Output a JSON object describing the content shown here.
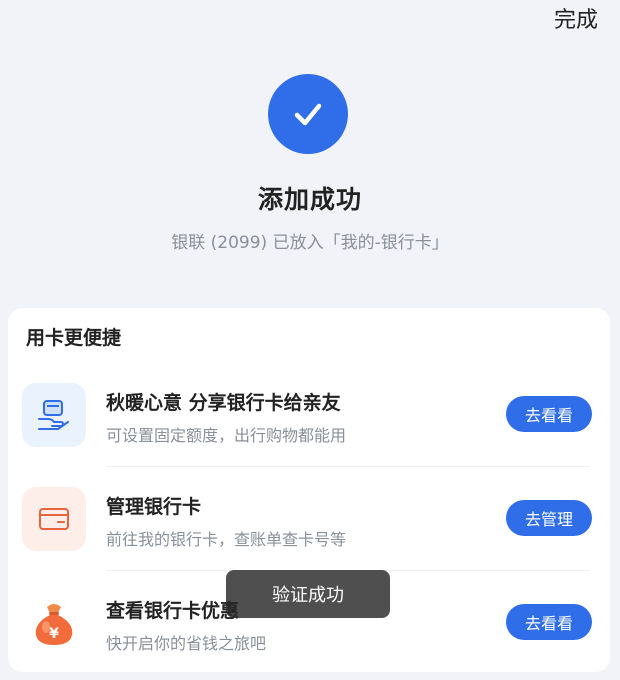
{
  "header": {
    "done_label": "完成"
  },
  "success": {
    "title": "添加成功",
    "subtitle": "银联 (2099) 已放入「我的-银行卡」",
    "icon": "check-icon",
    "accent": "#2f6ee8"
  },
  "panel": {
    "title": "用卡更便捷",
    "items": [
      {
        "icon": "card-gift-hand-icon",
        "title": "秋暖心意 分享银行卡给亲友",
        "desc": "可设置固定额度，出行购物都能用",
        "button": "去看看"
      },
      {
        "icon": "credit-card-icon",
        "title": "管理银行卡",
        "desc": "前往我的银行卡，查账单查卡号等",
        "button": "去管理"
      },
      {
        "icon": "money-bag-icon",
        "title": "查看银行卡优惠",
        "desc": "快开启你的省钱之旅吧",
        "button": "去看看"
      }
    ]
  },
  "toast": {
    "text": "验证成功"
  }
}
